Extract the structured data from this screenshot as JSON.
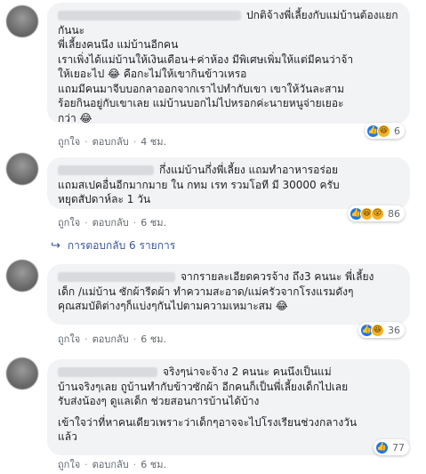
{
  "comments": [
    {
      "lines": [
        "ปกติจ้างพี่เลี้ยงกับแม่บ้านต้องแยกกันนะ",
        "พี่เลี้ยงคนนึง แม่บ้านอีกคน",
        "เราเพิ่งได้แม่บ้านให้เงินเดือน+ค่าห้อง มีพิเศษเพิ่มให้แต่มีคนว่าจ้า",
        "ให้เยอะไป 😂 คือกะไม่ให้เขากินข้าวเหรอ",
        "แถมมีคนมาจีบบอกลาออกจากเราไปทำกับเขา เขาให้วันละสาม",
        "ร้อยกินอยู่กับเขาเลย แม่บ้านบอกไม่ไปหรอกค่ะนายหนูจ่ายเยอะ",
        "กว่า 😂"
      ],
      "like": "ถูกใจ",
      "reply": "ตอบกลับ",
      "time": "4 ชม.",
      "reactions": {
        "icons": [
          "like-icon",
          "haha-icon"
        ],
        "count": "6"
      }
    },
    {
      "lines": [
        "กึ่งแม่บ้านกึ่งพี่เลี้ยง แถมทำอาหารอร่อย",
        "แถมสเปคอื่นอีกมากมาย ใน กทม เรท รวมโอที มี 30000 ครับ",
        "หยุดสัปดาห์ละ 1 วัน"
      ],
      "like": "ถูกใจ",
      "reply": "ตอบกลับ",
      "time": "6 ชม.",
      "reactions": {
        "icons": [
          "like-icon",
          "haha-icon",
          "wow-icon"
        ],
        "count": "86"
      }
    },
    {
      "lines": [
        "จากรายละเอียดควรจ้าง ถึง3 คนนะ พี่เลี้ยง",
        "เด็ก /แม่บ้าน ซักผ้ารีดผ้า ทำความสะอาด/แม่ครัวจากโรงแรมดังๆ",
        "คุณสมบัติต่างๆก็แบ่งๆกันไปตามความเหมาะสม 😂"
      ],
      "like": "ถูกใจ",
      "reply": "ตอบกลับ",
      "time": "6 ชม.",
      "reactions": {
        "icons": [
          "like-icon",
          "haha-icon"
        ],
        "count": "36"
      }
    },
    {
      "lines": [
        "จริงๆน่าจะจ้าง 2 คนนะ คนนึงเป็นแม่",
        "บ้านจริงๆเลย ถูบ้านทำกับข้าวซักผ้า อีกคนก็เป็นพี่เลี้ยงเด็กไปเลย",
        "รับส่งน้องๆ ดูแลเด็ก ช่วยสอนการบ้านได้บ้าง"
      ],
      "lines2": [
        "เข้าใจว่าที่หาคนเดียวเพราะว่าเด็กๆอาจจะไปโรงเรียนช่วงกลางวัน",
        "แล้ว"
      ],
      "like": "ถูกใจ",
      "reply": "ตอบกลับ",
      "time": "6 ชม.",
      "reactions": {
        "icons": [
          "like-icon"
        ],
        "count": "77"
      }
    }
  ],
  "view_replies": "การตอบกลับ 6 รายการ",
  "separator": "·"
}
